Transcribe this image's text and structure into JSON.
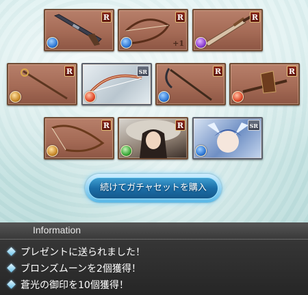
{
  "cards": [
    {
      "rarity": "R",
      "element": "water",
      "element_color": "#2f78d6",
      "plus": ""
    },
    {
      "rarity": "R",
      "element": "water",
      "element_color": "#2f78d6",
      "plus": "+1"
    },
    {
      "rarity": "R",
      "element": "dark",
      "element_color": "#8b3fd1",
      "plus": ""
    },
    {
      "rarity": "R",
      "element": "earth",
      "element_color": "#c98a2a",
      "plus": ""
    },
    {
      "rarity": "SR",
      "element": "fire",
      "element_color": "#e0492a",
      "plus": ""
    },
    {
      "rarity": "R",
      "element": "water",
      "element_color": "#2f78d6",
      "plus": ""
    },
    {
      "rarity": "R",
      "element": "fire",
      "element_color": "#e0492a",
      "plus": ""
    },
    {
      "rarity": "R",
      "element": "earth",
      "element_color": "#c98a2a",
      "plus": ""
    },
    {
      "rarity": "R",
      "element": "wind",
      "element_color": "#3aa83a",
      "plus": ""
    },
    {
      "rarity": "SR",
      "element": "water",
      "element_color": "#2f78d6",
      "plus": ""
    }
  ],
  "buy_button": {
    "label": "続けてガチャセットを購入"
  },
  "information": {
    "title": "Information",
    "lines": [
      "プレゼントに送られました！",
      "ブロンズムーンを2個獲得！",
      "蒼光の御印を10個獲得！"
    ]
  }
}
